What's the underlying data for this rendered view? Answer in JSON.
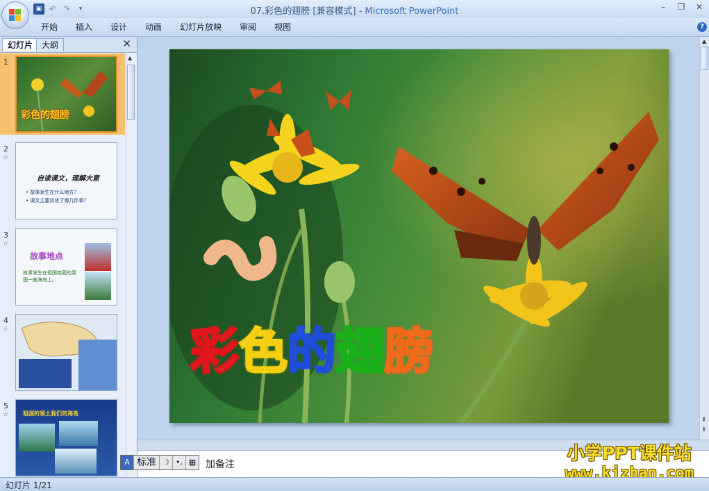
{
  "window": {
    "title_prefix": "07.彩色的翅膀 [兼容模式] - ",
    "app_name": "Microsoft PowerPoint"
  },
  "ribbon": {
    "tabs": [
      "开始",
      "插入",
      "设计",
      "动画",
      "幻灯片放映",
      "审阅",
      "视图"
    ]
  },
  "left_pane": {
    "tabs": {
      "slides": "幻灯片",
      "outline": "大纲"
    },
    "close_label": "✕",
    "thumbnails": [
      {
        "num": "1",
        "title": "彩色的翅膀",
        "selected": true,
        "star": ""
      },
      {
        "num": "2",
        "title": "自读课文，理解大意",
        "bullets": [
          "• 故事发生在什么地方？",
          "• 课文主要讲述了哪几件事？"
        ],
        "star": "☆"
      },
      {
        "num": "3",
        "title": "故事地点",
        "text": "故事发生在祖国南面的我国一座海岛上。",
        "star": "☆"
      },
      {
        "num": "4",
        "star": "☆"
      },
      {
        "num": "5",
        "title": "祖国的领土我们的海岛",
        "star": "☆"
      }
    ]
  },
  "slide": {
    "title_chars": [
      "彩",
      "色",
      "的",
      "翅",
      "膀"
    ],
    "title_colors": [
      "#e0161c",
      "#f5cf11",
      "#1f4fd8",
      "#1ab01a",
      "#ef6a1a"
    ]
  },
  "notes": {
    "placeholder": "加备注"
  },
  "ime": {
    "label": "标准",
    "moon": "☽",
    "dots": "•,",
    "keyboard": "▦"
  },
  "status": {
    "slide_counter": "幻灯片 1/21"
  },
  "watermark": {
    "line1": "小学PPT课件站",
    "line2": "www.kjzhan.com"
  }
}
